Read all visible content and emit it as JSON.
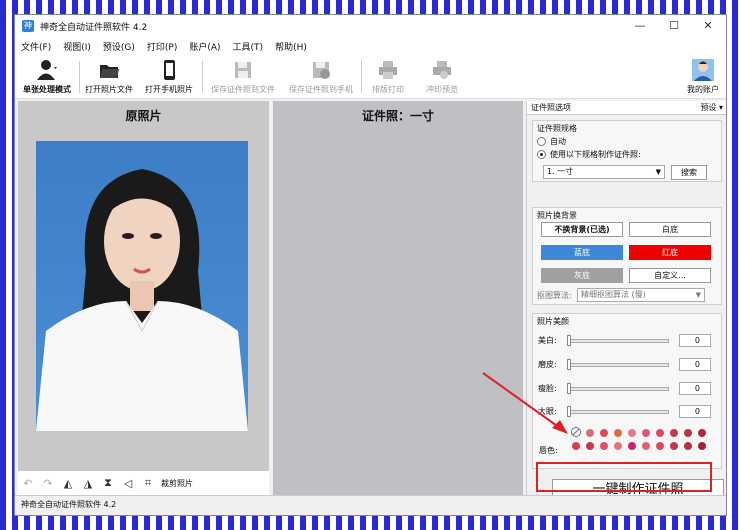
{
  "window": {
    "title": "神奇全自动证件照软件 4.2",
    "controls": [
      "—",
      "☐",
      "✕"
    ]
  },
  "menu": [
    "文件(F)",
    "视图(I)",
    "预设(G)",
    "打印(P)",
    "账户(A)",
    "工具(T)",
    "帮助(H)"
  ],
  "toolbar": {
    "buttons": [
      {
        "label": "单张处理模式",
        "icon": "person-icon",
        "enabled": true
      },
      {
        "label": "打开照片文件",
        "icon": "folder-icon",
        "enabled": true
      },
      {
        "label": "打开手机照片",
        "icon": "phone-icon",
        "enabled": true
      },
      {
        "label": "保存证件照到文件",
        "icon": "save-icon",
        "enabled": false
      },
      {
        "label": "保存证件照到手机",
        "icon": "save-phone-icon",
        "enabled": false
      },
      {
        "label": "排版打印",
        "icon": "printer-icon",
        "enabled": false
      },
      {
        "label": "冲印预览",
        "icon": "print-preview-icon",
        "enabled": false
      }
    ],
    "account": "我的账户"
  },
  "left_panel": {
    "title": "原照片",
    "crop_label": "裁剪照片"
  },
  "mid_panel": {
    "title": "证件照：一寸"
  },
  "right_panel": {
    "header": "证件照选项",
    "preset": "预设",
    "spec": {
      "title": "证件照规格",
      "auto": "自动",
      "custom": "使用以下规格制作证件照:",
      "size": "1. 一寸",
      "search": "搜索"
    },
    "background": {
      "title": "照片换背景",
      "keep": "不换背景(已选)",
      "white": "白底",
      "blue": "蓝底",
      "red": "红底",
      "gray": "灰底",
      "custom": "自定义...",
      "algo_label": "抠图算法:",
      "algo_value": "精细抠图算法 (慢)"
    },
    "beauty": {
      "title": "照片美颜",
      "sliders": [
        {
          "label": "美白:",
          "value": "0"
        },
        {
          "label": "磨皮:",
          "value": "0"
        },
        {
          "label": "瘦脸:",
          "value": "0"
        },
        {
          "label": "大眼:",
          "value": "0"
        }
      ],
      "lip_label": "唇色:"
    },
    "make_button": "一键制作证件照"
  },
  "colors": {
    "blue": "#3f88d8",
    "red": "#f00000",
    "gray": "#a0a0a0",
    "highlight": "#d22222"
  },
  "status": "神奇全自动证件照软件 4.2"
}
